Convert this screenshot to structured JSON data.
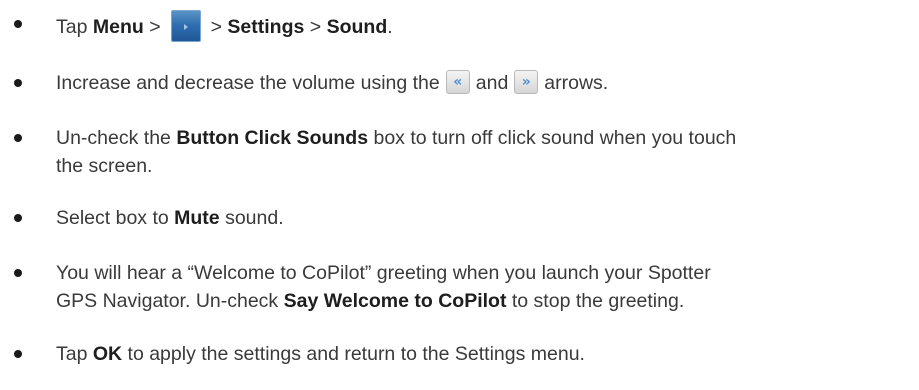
{
  "steps": [
    {
      "line1": {
        "prefix": "Tap ",
        "menu": "Menu",
        "sep1": " >",
        "sep2": "> ",
        "settings": "Settings",
        "sep3": " > ",
        "sound": "Sound",
        "end": "."
      }
    },
    {
      "line1": {
        "prefix": "Increase and decrease the volume using the",
        "mid": "and",
        "suffix": "arrows."
      }
    },
    {
      "line1": {
        "prefix": "Un-check the ",
        "bold": "Button Click Sounds",
        "suffix": " box to turn off click sound when you touch"
      },
      "line2": "the screen."
    },
    {
      "line1": {
        "prefix": "Select box to ",
        "bold": "Mute",
        "suffix": " sound."
      }
    },
    {
      "line1": "You will hear a “Welcome to CoPilot” greeting when you launch your Spotter",
      "line2": {
        "prefix": "GPS Navigator. Un-check ",
        "bold": "Say Welcome to CoPilot",
        "suffix": " to stop the greeting."
      }
    },
    {
      "line1": {
        "prefix": "Tap ",
        "bold": "OK",
        "suffix": " to apply the settings and return to the Settings menu."
      }
    }
  ],
  "icons": {
    "menu_button": "menu-forward-icon",
    "left_arrow": "chevron-left-icon",
    "right_arrow": "chevron-right-icon",
    "left_glyph": "«",
    "right_glyph": "»"
  },
  "colors": {
    "text": "#3a3a3a",
    "bold_text": "#1e1e1e",
    "menu_icon_blue": "#2f6fb1",
    "arrow_glyph": "#4f8fcf"
  }
}
